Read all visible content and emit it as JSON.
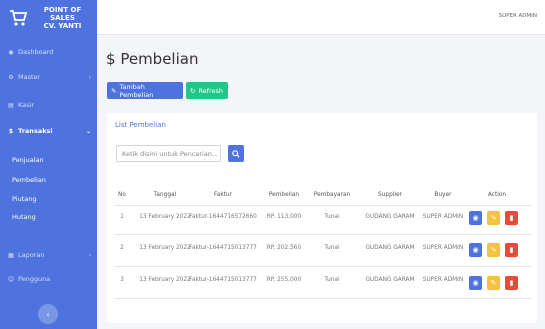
{
  "brand": {
    "line1": "POINT OF",
    "line2": "SALES",
    "line3": "CV. YANTI"
  },
  "sidebar": {
    "items": [
      {
        "label": "Dashboard",
        "icon": "dashboard-icon"
      },
      {
        "label": "Master",
        "icon": "gear-icon"
      },
      {
        "label": "Kasir",
        "icon": "cashier-icon"
      },
      {
        "label": "Transaksi",
        "icon": "dollar-icon"
      },
      {
        "label": "Laporan",
        "icon": "report-icon"
      },
      {
        "label": "Pengguna",
        "icon": "user-icon"
      }
    ],
    "subitems": [
      "Penjualan",
      "Pembelian",
      "Piutang",
      "Hutang"
    ],
    "toggle_label": "‹"
  },
  "topbar": {
    "user": "SUPER ADMIN"
  },
  "page": {
    "title_icon": "$",
    "title": "Pembelian"
  },
  "buttons": {
    "add": "Tambah Pembelian",
    "refresh": "Refresh"
  },
  "card": {
    "title": "List Pembelian",
    "search_placeholder": "Ketik disini untuk Pencarian..."
  },
  "table": {
    "headers": [
      "No",
      "Tanggal",
      "Faktur",
      "Pembelian",
      "Pembayaran",
      "Supplier",
      "Buyer",
      "Action"
    ],
    "rows": [
      [
        "1",
        "13 February 2022",
        "Faktur-1644716572660",
        "RP. 113,000",
        "Tunai",
        "GUDANG GARAM",
        "SUPER ADMIN"
      ],
      [
        "2",
        "13 February 2022",
        "Faktur-1644715013777",
        "RP. 202,560",
        "Tunai",
        "GUDANG GARAM",
        "SUPER ADMIN"
      ],
      [
        "3",
        "13 February 2022",
        "Faktur-1644715013777",
        "RP. 255,000",
        "Tunai",
        "GUDANG GARAM",
        "SUPER ADMIN"
      ]
    ]
  },
  "colors": {
    "primary": "#4e73df",
    "success": "#1cc88a",
    "warning": "#f6c23e",
    "danger": "#e74a3b"
  }
}
